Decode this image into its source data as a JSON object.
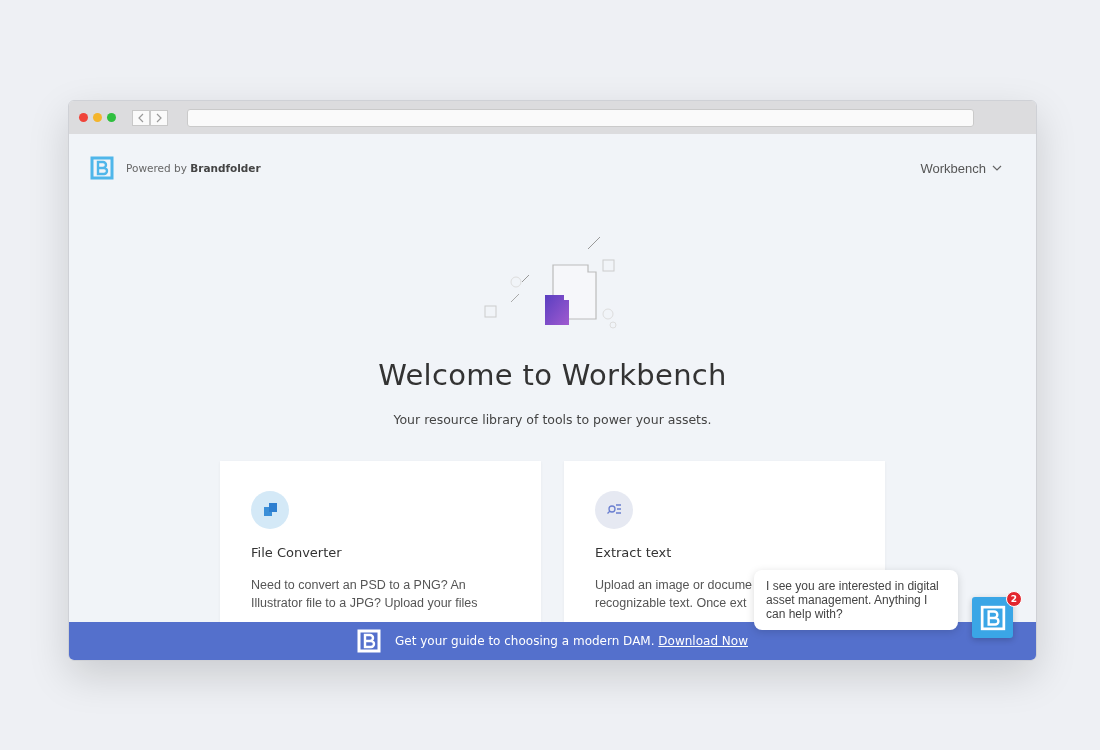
{
  "header": {
    "powered_by": "Powered by **Brandfolder**",
    "menu": "Workbench"
  },
  "hero": {
    "title": "Welcome to Workbench",
    "subtitle": "Your resource library of tools to power your assets."
  },
  "cards": [
    {
      "kind": "converter",
      "title": "File Converter",
      "description": "Need to convert an PSD to a PNG? An\nIllustrator file to a JPG? Upload your files"
    },
    {
      "kind": "extract",
      "title": "Extract text",
      "description": "Upload an image or docume\nrecognizable text. Once ext"
    }
  ],
  "banner": {
    "text": "Get your guide to choosing a modern DAM.",
    "link": "Download Now"
  },
  "chat": {
    "message": "I see you are interested in digital asset management. Anything I can help with?",
    "badge": "2"
  }
}
